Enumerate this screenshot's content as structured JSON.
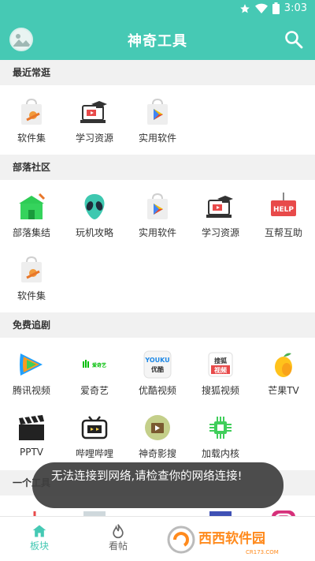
{
  "status_bar": {
    "time": "3:03"
  },
  "app_bar": {
    "title": "神奇工具"
  },
  "sections": {
    "recent": {
      "title": "最近常逛",
      "items": [
        "软件集",
        "学习资源",
        "实用软件"
      ]
    },
    "community": {
      "title": "部落社区",
      "items": [
        "部落集结",
        "玩机攻略",
        "实用软件",
        "学习资源",
        "互帮互助",
        "软件集"
      ],
      "help_badge": "HELP"
    },
    "drama": {
      "title": "免费追剧",
      "items": [
        "腾讯视频",
        "爱奇艺",
        "优酷视频",
        "搜狐视频",
        "芒果TV",
        "PPTV",
        "哔哩哔哩",
        "神奇影搜",
        "加载内核"
      ],
      "badges": {
        "iqiyi": "爱奇艺",
        "youku_top": "YOUKU",
        "youku_bottom": "优酷",
        "sohu_top": "搜狐",
        "sohu_bottom": "视频"
      }
    },
    "tools": {
      "title": "一个工具"
    }
  },
  "toast": {
    "message": "无法连接到网络,请检查你的网络连接!"
  },
  "bottom_nav": {
    "tabs": [
      "板块",
      "看帖"
    ]
  },
  "watermark": {
    "text": "西西软件园",
    "domain": "CR173.COM"
  },
  "colors": {
    "primary": "#46c9b4",
    "toast_bg": "#404040"
  }
}
